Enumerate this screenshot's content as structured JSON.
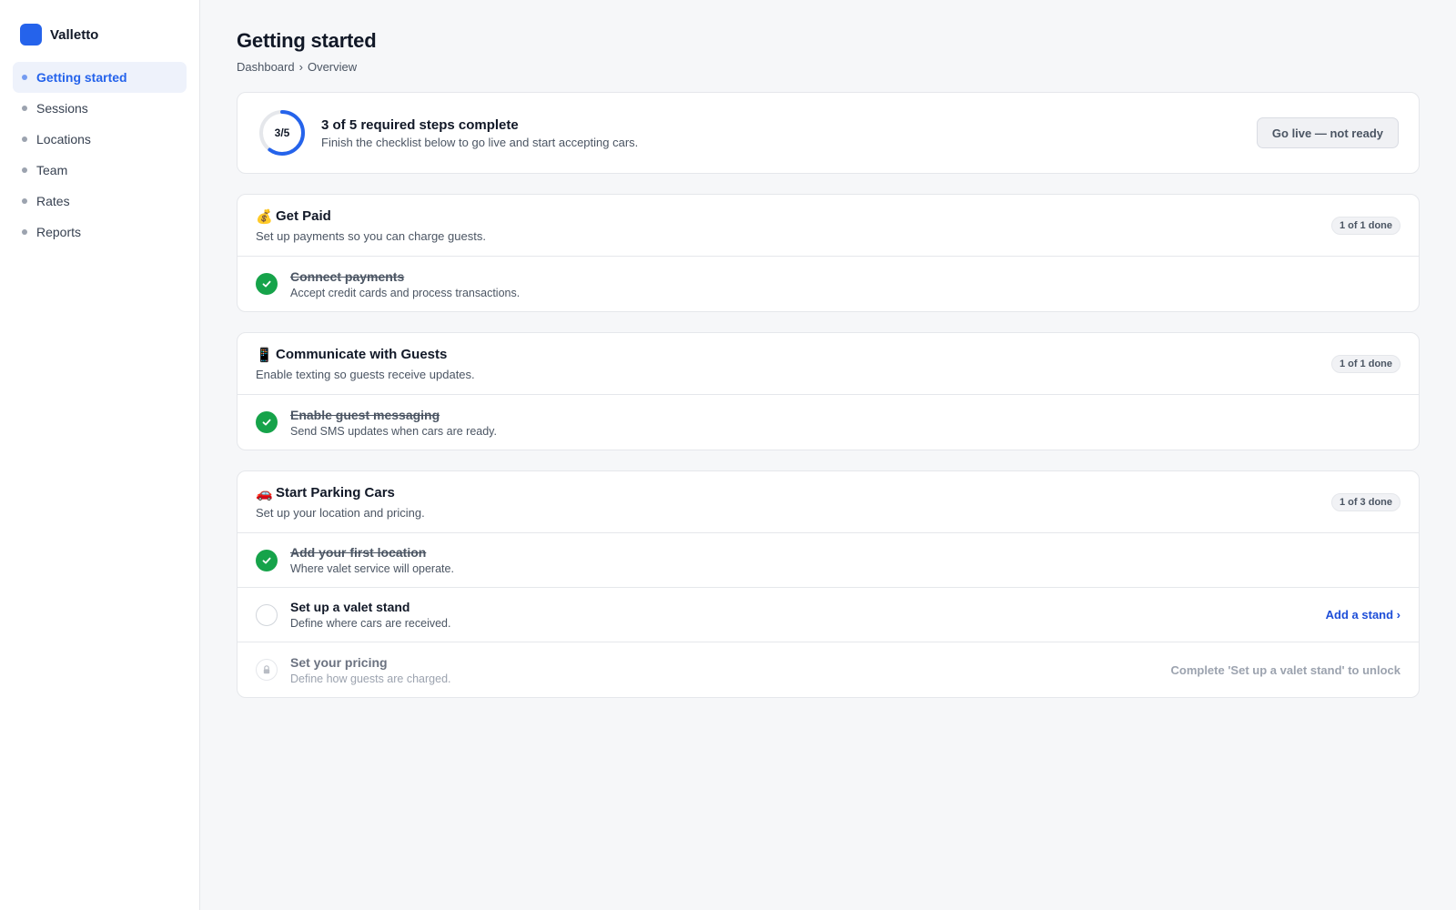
{
  "app": {
    "name": "Valletto",
    "brand_color": "#2563eb"
  },
  "sidebar": {
    "items": [
      {
        "label": "Getting started",
        "active": true
      },
      {
        "label": "Sessions"
      },
      {
        "label": "Locations"
      },
      {
        "label": "Team"
      },
      {
        "label": "Rates"
      },
      {
        "label": "Reports"
      }
    ]
  },
  "header": {
    "title": "Getting started",
    "breadcrumb": [
      "Dashboard",
      "›",
      "Overview"
    ]
  },
  "progress": {
    "ring_label": "3/5",
    "completed": 3,
    "total": 5,
    "title": "3 of 5 required steps complete",
    "subtitle": "Finish the checklist below to go live and start accepting cars.",
    "go_live_label": "Go live — not ready"
  },
  "sections": [
    {
      "emoji": "💰",
      "title": "Get Paid",
      "subtitle": "Set up payments so you can charge guests.",
      "badge": "1 of 1 done",
      "tasks": [
        {
          "title": "Connect payments",
          "subtitle": "Accept credit cards and process transactions.",
          "status": "done"
        }
      ]
    },
    {
      "emoji": "📱",
      "title": "Communicate with Guests",
      "subtitle": "Enable texting so guests receive updates.",
      "badge": "1 of 1 done",
      "tasks": [
        {
          "title": "Enable guest messaging",
          "subtitle": "Send SMS updates when cars are ready.",
          "status": "done"
        }
      ]
    },
    {
      "emoji": "🚗",
      "title": "Start Parking Cars",
      "subtitle": "Set up your location and pricing.",
      "badge": "1 of 3 done",
      "tasks": [
        {
          "title": "Add your first location",
          "subtitle": "Where valet service will operate.",
          "status": "done"
        },
        {
          "title": "Set up a valet stand",
          "subtitle": "Define where cars are received.",
          "status": "todo",
          "action": "Add a stand ›"
        },
        {
          "title": "Set your pricing",
          "subtitle": "Define how guests are charged.",
          "status": "locked",
          "lock_note": "Complete 'Set up a valet stand' to unlock"
        }
      ]
    }
  ],
  "colors": {
    "success": "#16a34a",
    "link": "#1d4ed8",
    "muted": "#9ca3af"
  }
}
